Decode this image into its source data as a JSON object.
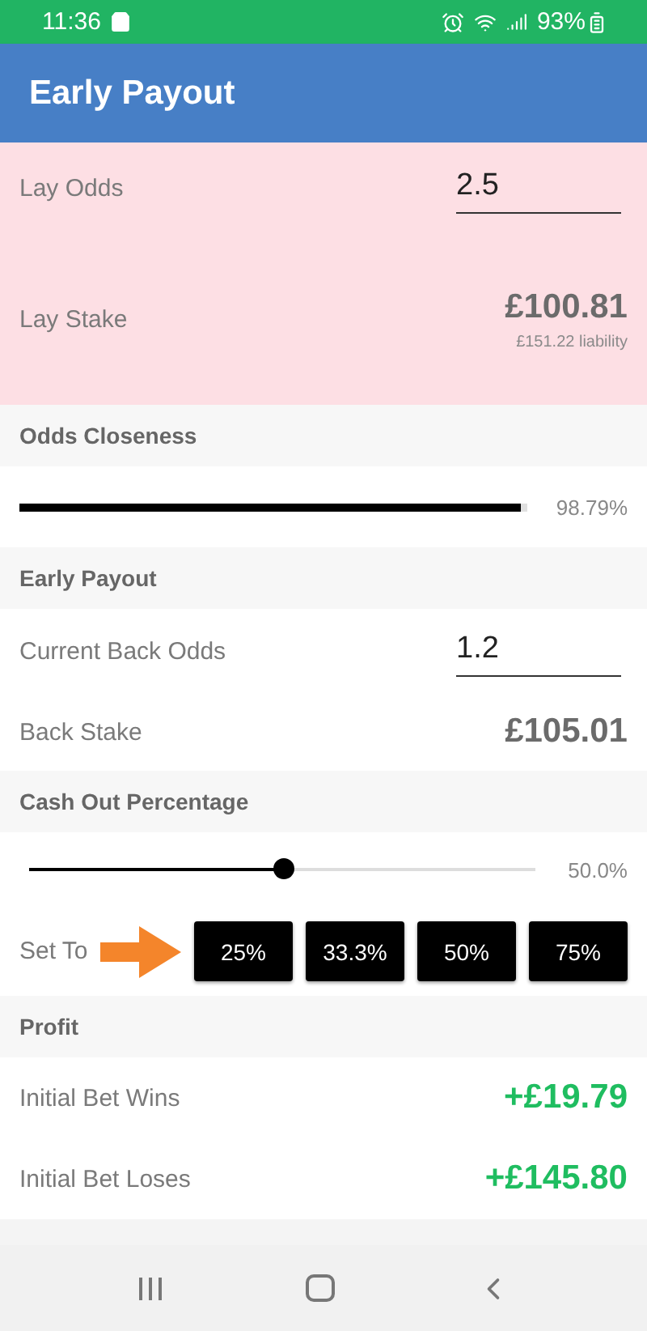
{
  "status_bar": {
    "time": "11:36",
    "battery": "93%"
  },
  "app_bar": {
    "title": "Early Payout"
  },
  "lay": {
    "odds": {
      "label": "Lay Odds",
      "value": "2.5"
    },
    "stake": {
      "label": "Lay Stake",
      "value": "£100.81",
      "note": "£151.22 liability"
    }
  },
  "closeness": {
    "header": "Odds Closeness",
    "level": 0.9879,
    "reading": "98.79%"
  },
  "early_payout": {
    "header": "Early Payout",
    "odds": {
      "label": "Current Back Odds",
      "value": "1.2"
    },
    "stake": {
      "label": "Back Stake",
      "value": "£105.01"
    }
  },
  "cash_out": {
    "header": "Cash Out Percentage",
    "level": 0.5,
    "reading": "50.0%",
    "set_to_label": "Set To",
    "presets": [
      "25%",
      "33.3%",
      "50%",
      "75%"
    ]
  },
  "profit": {
    "header": "Profit",
    "rows": [
      {
        "label": "Initial Bet Wins",
        "value": "+£19.79"
      },
      {
        "label": "Initial Bet Loses",
        "value": "+£145.80"
      }
    ]
  }
}
